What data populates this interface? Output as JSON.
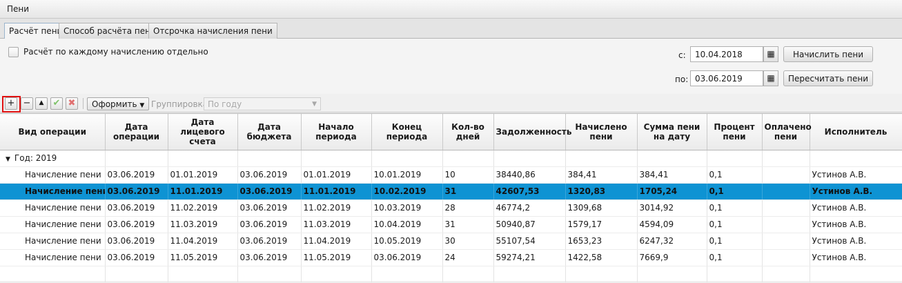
{
  "window": {
    "title": "Пени"
  },
  "tabs": [
    {
      "label": "Расчёт пени",
      "active": true
    },
    {
      "label": "Способ расчёта пени",
      "active": false
    },
    {
      "label": "Отсрочка начисления пени",
      "active": false
    }
  ],
  "options": {
    "separate_calc_label": "Расчёт по каждому начислению отдельно",
    "separate_calc_checked": false
  },
  "period": {
    "from_label": "с:",
    "from_value": "10.04.2018",
    "to_label": "по:",
    "to_value": "03.06.2019",
    "calc_button": "Начислить пени",
    "recalc_button": "Пересчитать пени",
    "calendar_icon": "calendar-icon"
  },
  "toolbar": {
    "add": "+",
    "remove": "−",
    "up": "▲",
    "format_label": "Оформить",
    "grouping_label": "Группировка",
    "grouping_value": "По году",
    "accent_highlight": "#e01010"
  },
  "table": {
    "columns": [
      "Вид операции",
      "Дата операции",
      "Дата лицевого счета",
      "Дата бюджета",
      "Начало периода",
      "Конец периода",
      "Кол-во дней",
      "Задолженность",
      "Начислено пени",
      "Сумма пени на дату",
      "Процент пени",
      "Оплачено пени",
      "Исполнитель"
    ],
    "group_label": "Год: 2019",
    "selected_color": "#0e93d3",
    "rows": [
      [
        "Начисление пени",
        "03.06.2019",
        "01.01.2019",
        "03.06.2019",
        "01.01.2019",
        "10.01.2019",
        "10",
        "38440,86",
        "384,41",
        "384,41",
        "0,1",
        "",
        "Устинов А.В."
      ],
      [
        "Начисление пени",
        "03.06.2019",
        "11.01.2019",
        "03.06.2019",
        "11.01.2019",
        "10.02.2019",
        "31",
        "42607,53",
        "1320,83",
        "1705,24",
        "0,1",
        "",
        "Устинов А.В."
      ],
      [
        "Начисление пени",
        "03.06.2019",
        "11.02.2019",
        "03.06.2019",
        "11.02.2019",
        "10.03.2019",
        "28",
        "46774,2",
        "1309,68",
        "3014,92",
        "0,1",
        "",
        "Устинов А.В."
      ],
      [
        "Начисление пени",
        "03.06.2019",
        "11.03.2019",
        "03.06.2019",
        "11.03.2019",
        "10.04.2019",
        "31",
        "50940,87",
        "1579,17",
        "4594,09",
        "0,1",
        "",
        "Устинов А.В."
      ],
      [
        "Начисление пени",
        "03.06.2019",
        "11.04.2019",
        "03.06.2019",
        "11.04.2019",
        "10.05.2019",
        "30",
        "55107,54",
        "1653,23",
        "6247,32",
        "0,1",
        "",
        "Устинов А.В."
      ],
      [
        "Начисление пени",
        "03.06.2019",
        "11.05.2019",
        "03.06.2019",
        "11.05.2019",
        "03.06.2019",
        "24",
        "59274,21",
        "1422,58",
        "7669,9",
        "0,1",
        "",
        "Устинов А.В."
      ]
    ],
    "selected_row": 1
  }
}
